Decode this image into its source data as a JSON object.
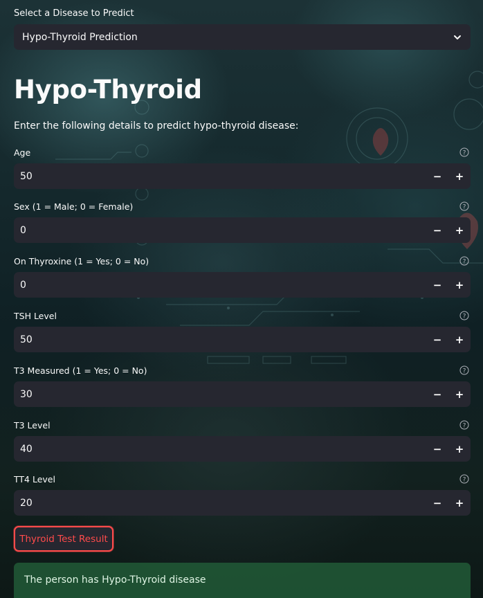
{
  "disease_select": {
    "label": "Select a Disease to Predict",
    "value": "Hypo-Thyroid Prediction"
  },
  "page": {
    "title": "Hypo-Thyroid",
    "intro": "Enter the following details to predict hypo-thyroid disease:"
  },
  "fields": [
    {
      "label": "Age",
      "value": "50"
    },
    {
      "label": "Sex (1 = Male; 0 = Female)",
      "value": "0"
    },
    {
      "label": "On Thyroxine (1 = Yes; 0 = No)",
      "value": "0"
    },
    {
      "label": "TSH Level",
      "value": "50"
    },
    {
      "label": "T3 Measured (1 = Yes; 0 = No)",
      "value": "30"
    },
    {
      "label": "T3 Level",
      "value": "40"
    },
    {
      "label": "TT4 Level",
      "value": "20"
    }
  ],
  "stepper": {
    "minus": "−",
    "plus": "+"
  },
  "action": {
    "button_label": "Thyroid Test Result"
  },
  "result": {
    "message": "The person has Hypo-Thyroid disease"
  },
  "colors": {
    "accent": "#ff4b4b",
    "input_bg": "#262730",
    "success_bg": "#215a37"
  }
}
